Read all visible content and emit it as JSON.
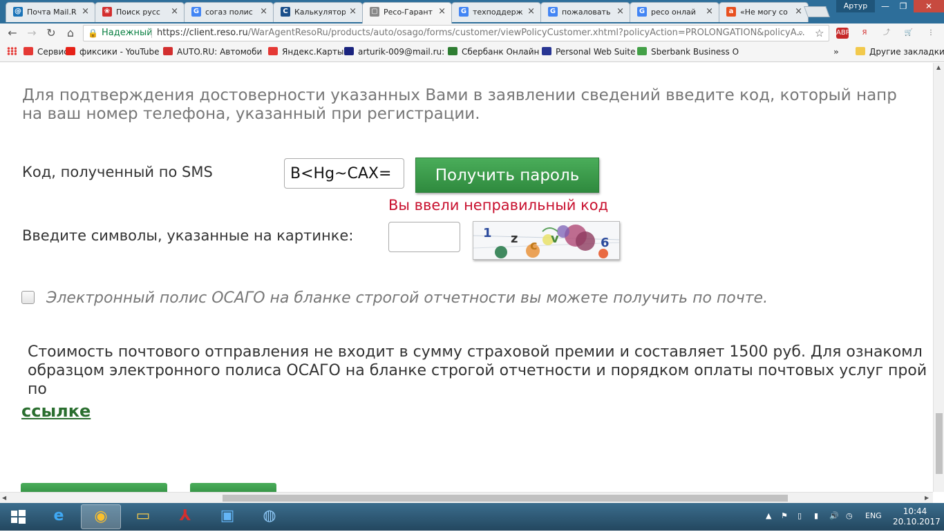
{
  "browser": {
    "tabs": [
      {
        "label": "Почта Mail.R",
        "color": "#1a73b8",
        "glyph": "@"
      },
      {
        "label": "Поиск русс",
        "color": "#d32f2f",
        "glyph": "❀"
      },
      {
        "label": "согаз полис",
        "color": "#4285f4",
        "glyph": "G"
      },
      {
        "label": "Калькулятор",
        "color": "#1b4f8a",
        "glyph": "C"
      },
      {
        "label": "Ресо-Гарант",
        "color": "#888888",
        "glyph": "▢"
      },
      {
        "label": "техподдерж",
        "color": "#4285f4",
        "glyph": "G"
      },
      {
        "label": "пожаловать",
        "color": "#4285f4",
        "glyph": "G"
      },
      {
        "label": "ресо онлай",
        "color": "#4285f4",
        "glyph": "G"
      },
      {
        "label": "«Не могу со",
        "color": "#e8501f",
        "glyph": "a"
      }
    ],
    "active_tab_index": 4,
    "tab_close": "×",
    "profile_name": "Артур",
    "window_controls": {
      "minimize": "—",
      "restore": "❐",
      "close": "✕"
    },
    "nav": {
      "back": "←",
      "forward": "→",
      "reload": "↻",
      "home": "⌂"
    },
    "omnibox": {
      "lock": "🔒",
      "secure_label": "Надежный",
      "url_host": "https://client.reso.ru",
      "url_path": "/WarAgentResoRu/products/auto/osago/forms/customer/viewPolicyCustomer.xhtml?policyAction=PROLONGATION&policyA...",
      "zoom_icon": "⌕",
      "star_icon": "☆"
    },
    "extensions": [
      {
        "label": "ABP",
        "bg": "#c62828",
        "fg": "#ffffff"
      },
      {
        "label": "Я",
        "bg": "#f5f5f5",
        "fg": "#d32f2f"
      },
      {
        "label": "⤴",
        "bg": "#f5f5f5",
        "fg": "#999999"
      },
      {
        "label": "🛒",
        "bg": "#f5f5f5",
        "fg": "#d32f2f"
      },
      {
        "label": "⋮",
        "bg": "#f5f5f5",
        "fg": "#555555"
      }
    ],
    "bookmarks": [
      {
        "label": "Сервисы",
        "color": "#e53935"
      },
      {
        "label": "фиксики - YouTube",
        "color": "#e62117"
      },
      {
        "label": "AUTO.RU: Автомоби",
        "color": "#d32f2f"
      },
      {
        "label": "Яндекс.Карты",
        "color": "#e53935"
      },
      {
        "label": "arturik-009@mail.ru:",
        "color": "#1a237e"
      },
      {
        "label": "Сбербанк Онлайн",
        "color": "#2e7d32"
      },
      {
        "label": "Personal Web Suite",
        "color": "#283593"
      },
      {
        "label": "Sberbank Business O",
        "color": "#43a047"
      }
    ],
    "bookmarks_more": "»",
    "other_bookmarks": "Другие закладки"
  },
  "page": {
    "notice_line1": "Для подтверждения достоверности указанных Вами в заявлении сведений введите код, который напр",
    "notice_line2": "на ваш номер телефона, указанный при регистрации.",
    "sms_label": "Код, полученный по SMS",
    "sms_value": "B<Hg~CAX=",
    "get_password_button": "Получить пароль",
    "error_message": "Вы ввели неправильный код",
    "captcha_label": "Введите символы, указанные на картинке:",
    "captcha_input_value": "",
    "captcha_chars": [
      "1",
      "z",
      "c",
      "v",
      "6"
    ],
    "checkbox_checked": false,
    "checkbox_label": "Электронный полис ОСАГО на бланке строгой отчетности вы можете получить по почте.",
    "cost_line1": "Стоимость почтового отправления не входит в сумму страховой премии и составляет 1500 руб. Для ознакомл",
    "cost_line2": "образцом электронного полиса ОСАГО на бланке строгой отчетности и порядком оплаты почтовых услуг прой",
    "cost_line3": "по",
    "link_text": "ссылке"
  },
  "scrollbars": {
    "left_arrow": "◀",
    "right_arrow": "▶",
    "up_arrow": "▲",
    "down_arrow": "▼"
  },
  "taskbar": {
    "start_icon": "windows-logo",
    "apps": [
      {
        "name": "internet-explorer-icon",
        "glyph": "e",
        "color": "#3fa9f5"
      },
      {
        "name": "chrome-icon",
        "glyph": "◉",
        "color": "#fbc02d"
      },
      {
        "name": "file-explorer-icon",
        "glyph": "▭",
        "color": "#f2c94c"
      },
      {
        "name": "adobe-reader-icon",
        "glyph": "⅄",
        "color": "#d32f2f"
      },
      {
        "name": "photo-viewer-icon",
        "glyph": "▣",
        "color": "#64b5f6"
      },
      {
        "name": "network-globe-icon",
        "glyph": "◍",
        "color": "#90caf9"
      }
    ],
    "tray": {
      "chevron": "▲",
      "flag": "⚑",
      "power": "▯",
      "signal": "▮",
      "volume": "🔊",
      "antivirus": "◷",
      "language": "ENG"
    },
    "time": "10:44",
    "date": "20.10.2017"
  }
}
